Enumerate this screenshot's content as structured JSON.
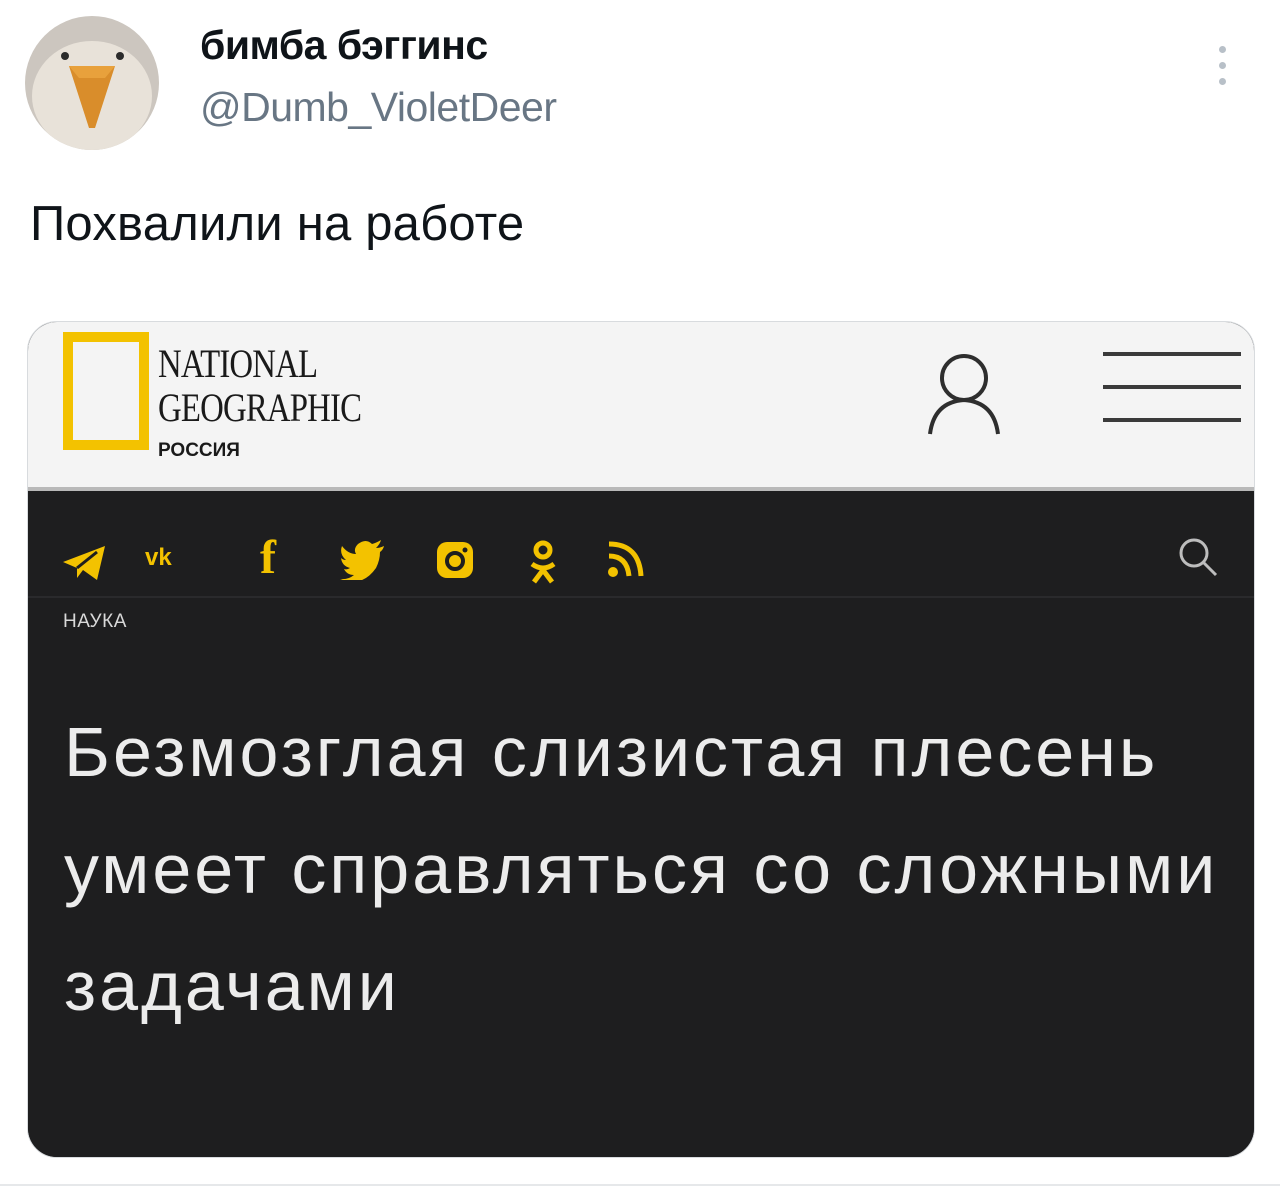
{
  "tweet": {
    "display_name": "бимба бэггинс",
    "handle": "@Dumb_VioletDeer",
    "text": "Похвалили на работе",
    "avatar_icon": "fox-avatar-icon",
    "more_icon": "more-vertical-icon"
  },
  "embedded_screenshot": {
    "logo": {
      "line1": "NATIONAL",
      "line2": "GEOGRAPHIC",
      "line3": "РОССИЯ",
      "frame_color": "#f3c200"
    },
    "header_icons": [
      "user-icon",
      "hamburger-menu-icon"
    ],
    "social_icons": [
      "telegram-icon",
      "vk-icon",
      "facebook-icon",
      "twitter-icon",
      "instagram-icon",
      "odnoklassniki-icon",
      "rss-icon"
    ],
    "social_labels": {
      "vk": "vk",
      "facebook": "f"
    },
    "search_icon": "search-icon",
    "section": "НАУКА",
    "headline": "Безмозглая слизистая плесень умеет справляться со сложными задачами",
    "accent_color": "#f3c200",
    "background_color": "#1e1e1f"
  }
}
